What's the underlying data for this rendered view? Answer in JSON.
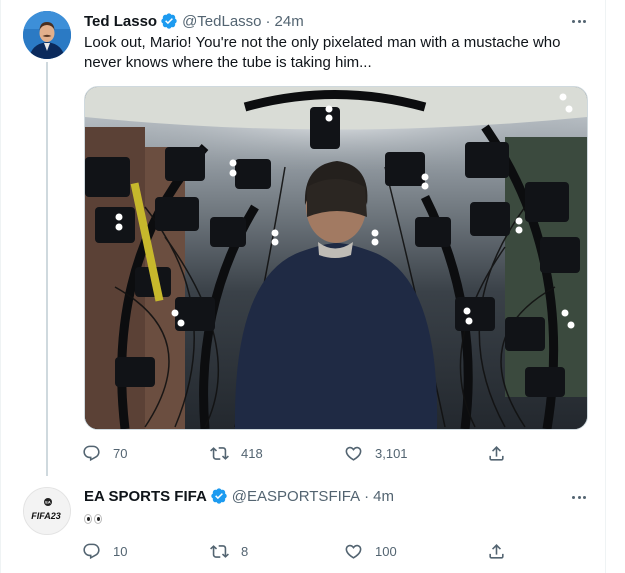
{
  "tweets": [
    {
      "name": "Ted Lasso",
      "handle": "@TedLasso",
      "separator": "·",
      "time": "24m",
      "text": "Look out, Mario! You're not the only pixelated man with a mustache who never knows where the tube is taking him...",
      "avatar_icon": "ted-lasso-avatar",
      "verified": true,
      "media": {
        "type": "photo",
        "alt": ""
      },
      "counts": {
        "replies": "70",
        "retweets": "418",
        "likes": "3,101"
      }
    },
    {
      "name": "EA SPORTS FIFA",
      "handle": "@EASPORTSFIFA",
      "separator": "·",
      "time": "4m",
      "text_emoji": "eyes-emoji",
      "avatar_icon": "fifa23-logo",
      "avatar_text": "FIFA23",
      "verified": true,
      "counts": {
        "replies": "10",
        "retweets": "8",
        "likes": "100"
      }
    }
  ],
  "colors": {
    "verified": "#1d9bf0",
    "text": "#0f1419",
    "secondary": "#536471",
    "thread_line": "#cfd9de"
  }
}
